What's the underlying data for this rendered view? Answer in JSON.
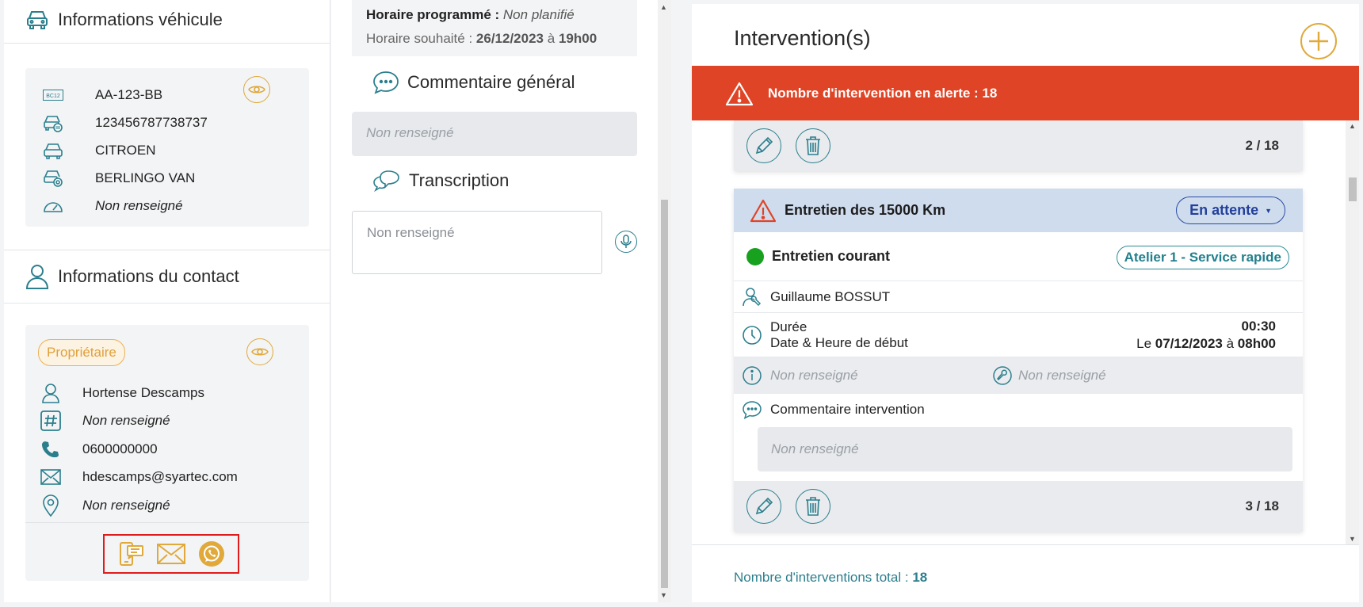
{
  "vehicle": {
    "title": "Informations véhicule",
    "plate": "AA-123-BB",
    "plate_badge": "BC12",
    "vin": "123456787738737",
    "brand": "CITROEN",
    "model": "BERLINGO VAN",
    "mileage": "Non renseigné"
  },
  "contact": {
    "title": "Informations du contact",
    "badge": "Propriétaire",
    "name": "Hortense Descamps",
    "id_number": "Non renseigné",
    "phone": "0600000000",
    "email": "hdescamps@syartec.com",
    "address": "Non renseigné"
  },
  "schedule": {
    "programmed_label": "Horaire programmé :",
    "programmed_value": "Non planifié",
    "desired_label": "Horaire souhaité :",
    "desired_date": "26/12/2023",
    "desired_sep": "à",
    "desired_time": "19h00"
  },
  "general_comment": {
    "title": "Commentaire général",
    "value": "Non renseigné"
  },
  "transcription": {
    "title": "Transcription",
    "placeholder": "Non renseigné"
  },
  "interventions": {
    "title": "Intervention(s)",
    "alert_text": "Nombre d'intervention en alerte : 18",
    "card_prev": {
      "pager": "2 / 18"
    },
    "card": {
      "title": "Entretien des 15000 Km",
      "status": "En attente",
      "type": "Entretien courant",
      "workshop": "Atelier 1 - Service rapide",
      "technician": "Guillaume BOSSUT",
      "duration_label": "Durée",
      "start_label": "Date & Heure de début",
      "duration_value": "00:30",
      "start_prefix": "Le",
      "start_date": "07/12/2023",
      "start_sep": "à",
      "start_time": "08h00",
      "info_note": "Non renseigné",
      "tool_note": "Non renseigné",
      "comment_label": "Commentaire intervention",
      "comment_value": "Non renseigné",
      "pager": "3 / 18"
    },
    "total_label": "Nombre d'interventions total :",
    "total_value": "18"
  },
  "colors": {
    "accent_teal": "#2b7f8d",
    "accent_gold": "#e0a93a",
    "alert_red": "#e04426",
    "status_blue": "#23409b",
    "dot_green": "#18a01f"
  }
}
